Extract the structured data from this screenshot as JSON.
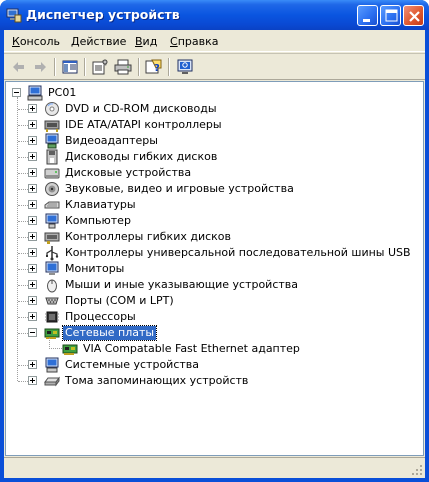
{
  "window": {
    "title": "Диспетчер устройств"
  },
  "menu": [
    {
      "pre": "",
      "ul": "К",
      "post": "онсоль"
    },
    {
      "pre": "",
      "ul": "Д",
      "post": "ействие"
    },
    {
      "pre": "",
      "ul": "В",
      "post": "ид"
    },
    {
      "pre": "",
      "ul": "С",
      "post": "правка"
    }
  ],
  "tree": {
    "root": "PC01",
    "items": [
      {
        "label": "DVD и CD-ROM дисководы",
        "icon": "cdrom-icon",
        "expanded": false
      },
      {
        "label": "IDE ATA/ATAPI контроллеры",
        "icon": "ide-controller-icon",
        "expanded": false
      },
      {
        "label": "Видеоадаптеры",
        "icon": "display-adapter-icon",
        "expanded": false
      },
      {
        "label": "Дисководы гибких дисков",
        "icon": "floppy-drive-icon",
        "expanded": false
      },
      {
        "label": "Дисковые устройства",
        "icon": "disk-drive-icon",
        "expanded": false
      },
      {
        "label": "Звуковые, видео и игровые устройства",
        "icon": "sound-icon",
        "expanded": false
      },
      {
        "label": "Клавиатуры",
        "icon": "keyboard-icon",
        "expanded": false
      },
      {
        "label": "Компьютер",
        "icon": "computer-icon",
        "expanded": false
      },
      {
        "label": "Контроллеры гибких дисков",
        "icon": "floppy-controller-icon",
        "expanded": false
      },
      {
        "label": "Контроллеры универсальной последовательной шины USB",
        "icon": "usb-icon",
        "expanded": false
      },
      {
        "label": "Мониторы",
        "icon": "monitor-icon",
        "expanded": false
      },
      {
        "label": "Мыши и иные указывающие устройства",
        "icon": "mouse-icon",
        "expanded": false
      },
      {
        "label": "Порты (COM и LPT)",
        "icon": "port-icon",
        "expanded": false
      },
      {
        "label": "Процессоры",
        "icon": "processor-icon",
        "expanded": false
      },
      {
        "label": "Сетевые платы",
        "icon": "network-card-icon",
        "expanded": true,
        "selected": true,
        "children": [
          {
            "label": "VIA Compatable Fast Ethernet адаптер",
            "icon": "network-card-icon"
          }
        ]
      },
      {
        "label": "Системные устройства",
        "icon": "system-device-icon",
        "expanded": false
      },
      {
        "label": "Тома запоминающих устройств",
        "icon": "storage-volume-icon",
        "expanded": false
      }
    ]
  }
}
